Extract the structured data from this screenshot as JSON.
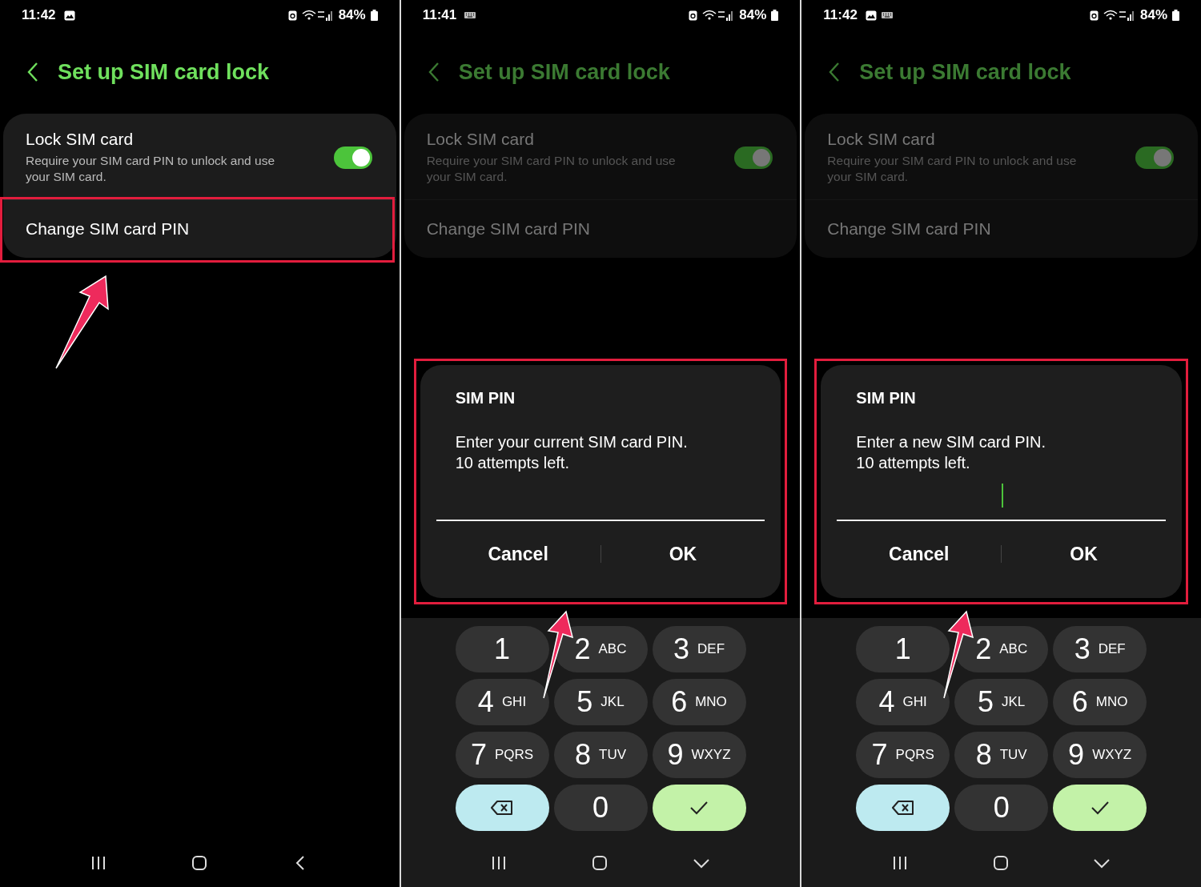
{
  "panels": [
    {
      "status_bar": {
        "time": "11:42",
        "notifications": [
          {
            "kind": "gallery"
          }
        ],
        "battery": "84%"
      },
      "header": {
        "title": "Set up SIM card lock"
      },
      "dimmed": false,
      "settings": [
        {
          "kind": "toggle",
          "title": "Lock SIM card",
          "description": "Require your SIM card PIN to unlock and use your SIM card.",
          "on": true,
          "highlighted": false
        },
        {
          "kind": "link",
          "title": "Change SIM card PIN",
          "highlighted": true
        }
      ],
      "arrow": true,
      "nav": [
        {
          "kind": "recent"
        },
        {
          "kind": "home"
        },
        {
          "kind": "back"
        }
      ]
    },
    {
      "status_bar": {
        "time": "11:41",
        "notifications": [
          {
            "kind": "keyboard"
          }
        ],
        "battery": "84%"
      },
      "header": {
        "title": "Set up SIM card lock"
      },
      "dimmed": true,
      "settings": [
        {
          "kind": "toggle",
          "title": "Lock SIM card",
          "description": "Require your SIM card PIN to unlock and use your SIM card.",
          "on": true,
          "highlighted": false
        },
        {
          "kind": "link",
          "title": "Change SIM card PIN",
          "highlighted": false
        }
      ],
      "dialog": {
        "title": "SIM PIN",
        "message": [
          "Enter your current SIM card PIN.",
          "10 attempts left."
        ],
        "cursor": false,
        "highlighted": true,
        "buttons": [
          "Cancel",
          "OK"
        ]
      },
      "keypad": [
        {
          "kind": "digit",
          "digit": "1"
        },
        {
          "kind": "digit",
          "digit": "2",
          "letters": "ABC"
        },
        {
          "kind": "digit",
          "digit": "3",
          "letters": "DEF"
        },
        {
          "kind": "digit",
          "digit": "4",
          "letters": "GHI"
        },
        {
          "kind": "digit",
          "digit": "5",
          "letters": "JKL"
        },
        {
          "kind": "digit",
          "digit": "6",
          "letters": "MNO"
        },
        {
          "kind": "digit",
          "digit": "7",
          "letters": "PQRS"
        },
        {
          "kind": "digit",
          "digit": "8",
          "letters": "TUV"
        },
        {
          "kind": "digit",
          "digit": "9",
          "letters": "WXYZ"
        },
        {
          "kind": "backspace"
        },
        {
          "kind": "digit",
          "digit": "0"
        },
        {
          "kind": "done"
        }
      ],
      "arrow": true,
      "nav": [
        {
          "kind": "recent"
        },
        {
          "kind": "home"
        },
        {
          "kind": "hide"
        }
      ]
    },
    {
      "status_bar": {
        "time": "11:42",
        "notifications": [
          {
            "kind": "gallery"
          },
          {
            "kind": "keyboard"
          }
        ],
        "battery": "84%"
      },
      "header": {
        "title": "Set up SIM card lock"
      },
      "dimmed": true,
      "settings": [
        {
          "kind": "toggle",
          "title": "Lock SIM card",
          "description": "Require your SIM card PIN to unlock and use your SIM card.",
          "on": true,
          "highlighted": false
        },
        {
          "kind": "link",
          "title": "Change SIM card PIN",
          "highlighted": false
        }
      ],
      "dialog": {
        "title": "SIM PIN",
        "message": [
          "Enter a new SIM card PIN.",
          "10 attempts left."
        ],
        "cursor": true,
        "highlighted": true,
        "buttons": [
          "Cancel",
          "OK"
        ]
      },
      "keypad": [
        {
          "kind": "digit",
          "digit": "1"
        },
        {
          "kind": "digit",
          "digit": "2",
          "letters": "ABC"
        },
        {
          "kind": "digit",
          "digit": "3",
          "letters": "DEF"
        },
        {
          "kind": "digit",
          "digit": "4",
          "letters": "GHI"
        },
        {
          "kind": "digit",
          "digit": "5",
          "letters": "JKL"
        },
        {
          "kind": "digit",
          "digit": "6",
          "letters": "MNO"
        },
        {
          "kind": "digit",
          "digit": "7",
          "letters": "PQRS"
        },
        {
          "kind": "digit",
          "digit": "8",
          "letters": "TUV"
        },
        {
          "kind": "digit",
          "digit": "9",
          "letters": "WXYZ"
        },
        {
          "kind": "backspace"
        },
        {
          "kind": "digit",
          "digit": "0"
        },
        {
          "kind": "done"
        }
      ],
      "arrow": true,
      "nav": [
        {
          "kind": "recent"
        },
        {
          "kind": "home"
        },
        {
          "kind": "hide"
        }
      ]
    }
  ]
}
